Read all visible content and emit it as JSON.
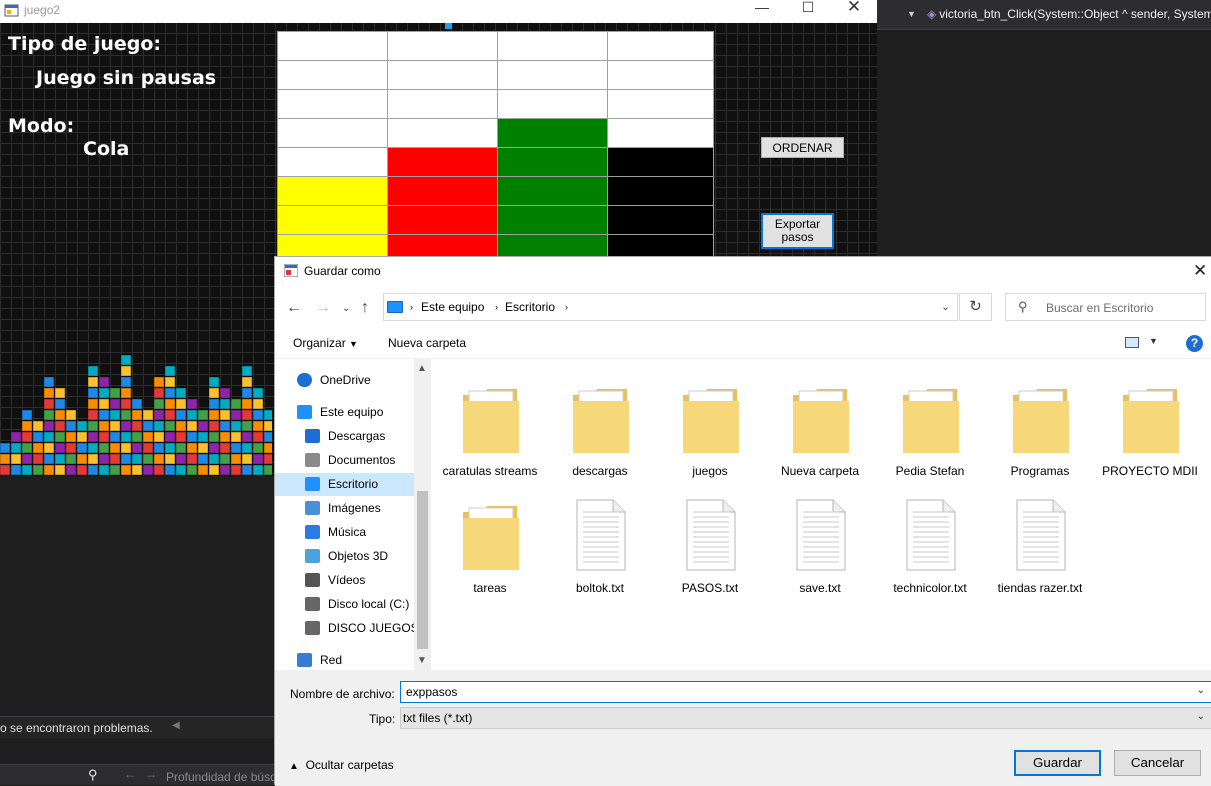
{
  "ide": {
    "method_signature": "victoria_btn_Click(System::Object ^ sender, System",
    "status": "o se encontraron problemas.",
    "search_placeholder": "Profundidad de búsq"
  },
  "game": {
    "window_title": "juego2",
    "tipo_label": "Tipo de juego:",
    "tipo_value": "Juego sin pausas",
    "modo_label": "Modo:",
    "modo_value": "Cola",
    "ordenar_label": "ORDENAR",
    "exportar_label": "Exportar pasos",
    "board": [
      [
        "#ffffff",
        "#ffffff",
        "#ffffff",
        "#ffffff"
      ],
      [
        "#ffffff",
        "#ffffff",
        "#ffffff",
        "#ffffff"
      ],
      [
        "#ffffff",
        "#ffffff",
        "#ffffff",
        "#ffffff"
      ],
      [
        "#ffffff",
        "#ffffff",
        "#008000",
        "#ffffff"
      ],
      [
        "#ffffff",
        "#ff0000",
        "#008000",
        "#000000"
      ],
      [
        "#ffff00",
        "#ff0000",
        "#008000",
        "#000000"
      ],
      [
        "#ffff00",
        "#ff0000",
        "#008000",
        "#000000"
      ],
      [
        "#ffff00",
        "#ff0000",
        "#008000",
        "#000000"
      ]
    ]
  },
  "dialog": {
    "title": "Guardar como",
    "breadcrumb": [
      "Este equipo",
      "Escritorio"
    ],
    "search_placeholder": "Buscar en Escritorio",
    "organize_label": "Organizar",
    "new_folder_label": "Nueva carpeta",
    "nav_items": [
      {
        "label": "OneDrive",
        "icon": "cloud-icon"
      },
      {
        "label": "Este equipo",
        "icon": "computer-icon"
      },
      {
        "label": "Descargas",
        "icon": "download-icon"
      },
      {
        "label": "Documentos",
        "icon": "document-icon"
      },
      {
        "label": "Escritorio",
        "icon": "desktop-icon",
        "selected": true
      },
      {
        "label": "Imágenes",
        "icon": "image-icon"
      },
      {
        "label": "Música",
        "icon": "music-icon"
      },
      {
        "label": "Objetos 3D",
        "icon": "cube-icon"
      },
      {
        "label": "Vídeos",
        "icon": "video-icon"
      },
      {
        "label": "Disco local (C:)",
        "icon": "drive-icon"
      },
      {
        "label": "DISCO JUEGOS (",
        "icon": "drive-icon"
      },
      {
        "label": "Red",
        "icon": "network-icon"
      }
    ],
    "files": [
      {
        "name": "caratulas streams",
        "kind": "folder"
      },
      {
        "name": "descargas",
        "kind": "folder"
      },
      {
        "name": "juegos",
        "kind": "folder"
      },
      {
        "name": "Nueva carpeta",
        "kind": "folder"
      },
      {
        "name": "Pedia Stefan",
        "kind": "folder"
      },
      {
        "name": "Programas",
        "kind": "folder"
      },
      {
        "name": "PROYECTO MDII",
        "kind": "folder"
      },
      {
        "name": "tareas",
        "kind": "folder"
      },
      {
        "name": "boltok.txt",
        "kind": "txt"
      },
      {
        "name": "PASOS.txt",
        "kind": "txt"
      },
      {
        "name": "save.txt",
        "kind": "txt"
      },
      {
        "name": "technicolor.txt",
        "kind": "txt"
      },
      {
        "name": "tiendas razer.txt",
        "kind": "txt"
      }
    ],
    "filename_label": "Nombre de archivo:",
    "filename_value": "exppasos",
    "type_label": "Tipo:",
    "type_value": "txt files (*.txt)",
    "hide_folders_label": "Ocultar carpetas",
    "save_label": "Guardar",
    "cancel_label": "Cancelar"
  }
}
